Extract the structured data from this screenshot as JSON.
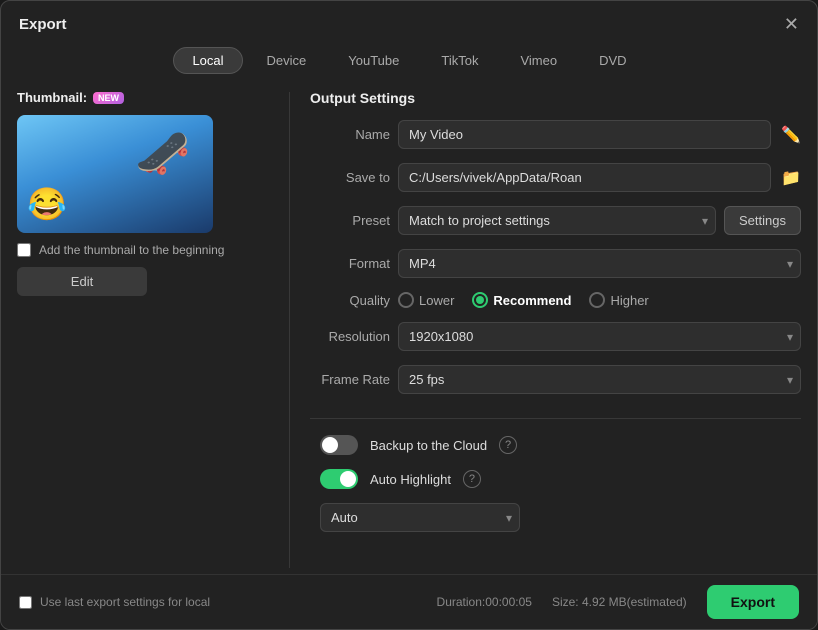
{
  "window": {
    "title": "Export",
    "close_label": "✕"
  },
  "tabs": [
    {
      "id": "local",
      "label": "Local",
      "active": true
    },
    {
      "id": "device",
      "label": "Device",
      "active": false
    },
    {
      "id": "youtube",
      "label": "YouTube",
      "active": false
    },
    {
      "id": "tiktok",
      "label": "TikTok",
      "active": false
    },
    {
      "id": "vimeo",
      "label": "Vimeo",
      "active": false
    },
    {
      "id": "dvd",
      "label": "DVD",
      "active": false
    }
  ],
  "left_panel": {
    "thumbnail_label": "Thumbnail:",
    "new_badge": "NEW",
    "checkbox_label": "Add the thumbnail to the beginning",
    "edit_button": "Edit"
  },
  "right_panel": {
    "section_title": "Output Settings",
    "name_label": "Name",
    "name_value": "My Video",
    "save_to_label": "Save to",
    "save_to_value": "C:/Users/vivek/AppData/Roan",
    "preset_label": "Preset",
    "preset_value": "Match to project settings",
    "settings_btn": "Settings",
    "format_label": "Format",
    "format_value": "MP4",
    "quality_label": "Quality",
    "quality_options": [
      "Lower",
      "Recommend",
      "Higher"
    ],
    "quality_selected": "Recommend",
    "resolution_label": "Resolution",
    "resolution_value": "1920x1080",
    "frame_rate_label": "Frame Rate",
    "frame_rate_value": "25 fps",
    "backup_label": "Backup to the Cloud",
    "backup_state": "off",
    "auto_highlight_label": "Auto Highlight",
    "auto_highlight_state": "on",
    "auto_dropdown": "Auto"
  },
  "footer": {
    "checkbox_label": "Use last export settings for local",
    "duration_label": "Duration:00:00:05",
    "size_label": "Size: 4.92 MB(estimated)",
    "export_btn": "Export"
  },
  "icons": {
    "ai": "✏️",
    "folder": "📁",
    "help": "?"
  }
}
